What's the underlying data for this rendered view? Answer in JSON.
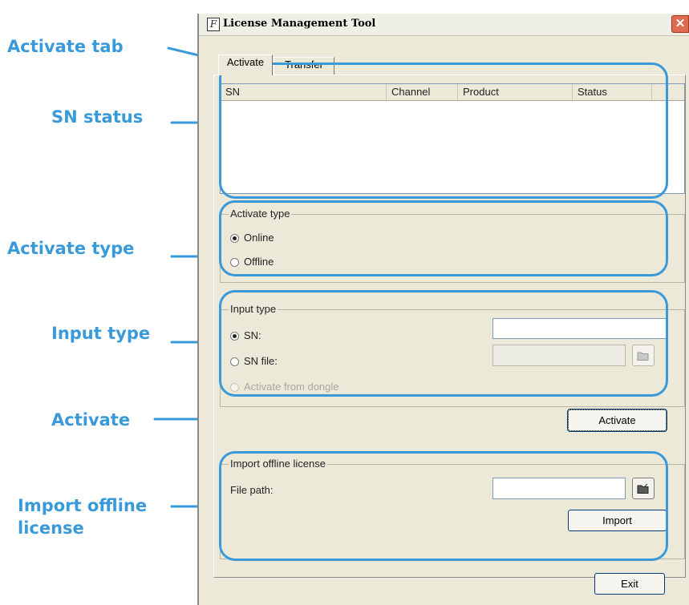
{
  "window": {
    "title": "License Management Tool",
    "app_icon_glyph": "F",
    "close_glyph": "✕"
  },
  "tabs": [
    {
      "label": "Activate",
      "selected": true
    },
    {
      "label": "Transfer",
      "selected": false
    }
  ],
  "sn_list": {
    "columns": [
      "SN",
      "Channel",
      "Product",
      "Status"
    ],
    "rows": []
  },
  "activate_type": {
    "legend": "Activate type",
    "options": [
      {
        "label": "Online",
        "selected": true
      },
      {
        "label": "Offline",
        "selected": false
      }
    ]
  },
  "input_type": {
    "legend": "Input type",
    "sn_label": "SN:",
    "sn_value": "",
    "sn_file_label": "SN file:",
    "sn_file_value": "",
    "dongle_label": "Activate from dongle",
    "selected": "SN"
  },
  "activate_button": "Activate",
  "import_offline": {
    "legend": "Import offline license",
    "file_path_label": "File path:",
    "file_path_value": "",
    "import_button": "Import"
  },
  "exit_button": "Exit",
  "callouts": {
    "activate_tab": "Activate tab",
    "sn_status": "SN status",
    "activate_type": "Activate type",
    "input_type": "Input type",
    "activate": "Activate",
    "import_offline_line1": "Import offline",
    "import_offline_line2": "license"
  },
  "colors": {
    "callout": "#3a9ad9",
    "window_bg": "#ece9d8"
  },
  "icons": {
    "browse": "folder-open-icon",
    "close": "close-icon"
  }
}
